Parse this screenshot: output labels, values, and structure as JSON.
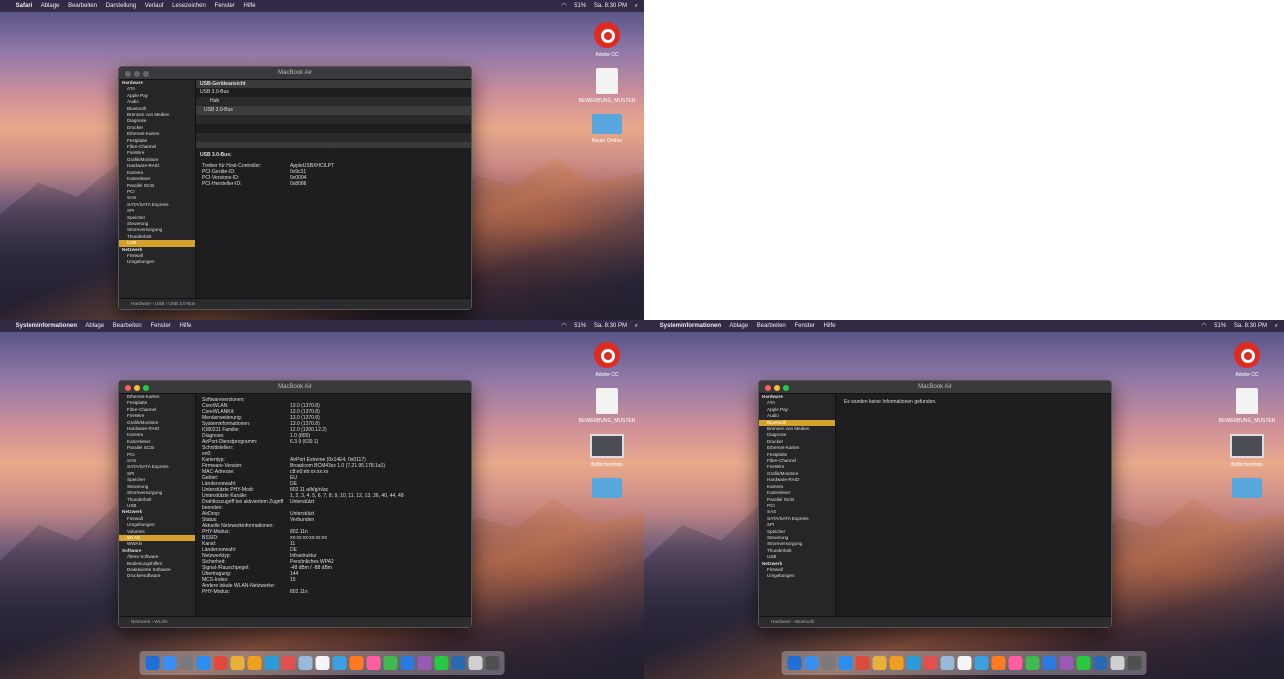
{
  "screens": [
    {
      "menu_app": "Safari",
      "menus": [
        "Ablage",
        "Bearbeiten",
        "Darstellung",
        "Verlauf",
        "Lesezeichen",
        "Fenster",
        "Hilfe"
      ],
      "clock": "Sa. 8:30 PM",
      "battery": "51%",
      "window_title": "MacBook Air",
      "sidebar": [
        {
          "label": "Hardware",
          "group": true
        },
        {
          "label": "ATA"
        },
        {
          "label": "Apple Pay"
        },
        {
          "label": "Audio"
        },
        {
          "label": "Bluetooth"
        },
        {
          "label": "Brennen von Medien"
        },
        {
          "label": "Diagnose"
        },
        {
          "label": "Drucker"
        },
        {
          "label": "Ethernet-Karten"
        },
        {
          "label": "Festplatte"
        },
        {
          "label": "Fibre-Channel"
        },
        {
          "label": "FireWire"
        },
        {
          "label": "Grafik/Monitore"
        },
        {
          "label": "Hardware-RAID"
        },
        {
          "label": "Kamera"
        },
        {
          "label": "Kartenleser"
        },
        {
          "label": "Parallel SCSI"
        },
        {
          "label": "PCI"
        },
        {
          "label": "SAS"
        },
        {
          "label": "SATA/SATA Express"
        },
        {
          "label": "SPI"
        },
        {
          "label": "Speicher"
        },
        {
          "label": "Steuerung"
        },
        {
          "label": "Stromversorgung"
        },
        {
          "label": "Thunderbolt"
        },
        {
          "label": "USB",
          "selected": true
        },
        {
          "label": "Netzwerk",
          "group": true
        },
        {
          "label": "Firewall"
        },
        {
          "label": "Umgebungen"
        }
      ],
      "tree_header": "USB-Geräteansicht",
      "tree": [
        "USB 3.0-Bus",
        "Hub",
        "USB 3.0-Bus"
      ],
      "detail_title": "USB 3.0-Bus:",
      "details": [
        {
          "k": "Treiber für Host-Controller:",
          "v": "AppleUSBXHCILPT"
        },
        {
          "k": "PCI-Geräte-ID:",
          "v": "0x9c31"
        },
        {
          "k": "PCI-Versions-ID:",
          "v": "0x0004"
        },
        {
          "k": "PCI-Hersteller-ID:",
          "v": "0x8086"
        }
      ],
      "breadcrumb": "Hardware › USB › USB 3.0-Bus"
    },
    {
      "menu_app": "Systeminformationen",
      "menus": [
        "Ablage",
        "Bearbeiten",
        "Fenster",
        "Hilfe"
      ],
      "clock": "Sa. 8:30 PM",
      "battery": "51%",
      "window_title": "MacBook Air",
      "sidebar": [
        {
          "label": "Ethernet-Karten"
        },
        {
          "label": "Festplatte"
        },
        {
          "label": "Fibre-Channel"
        },
        {
          "label": "FireWire"
        },
        {
          "label": "Grafik/Monitore"
        },
        {
          "label": "Hardware-RAID"
        },
        {
          "label": "Kamera"
        },
        {
          "label": "Kartenleser"
        },
        {
          "label": "Parallel SCSI"
        },
        {
          "label": "PCI"
        },
        {
          "label": "SAS"
        },
        {
          "label": "SATA/SATA Express"
        },
        {
          "label": "SPI"
        },
        {
          "label": "Speicher"
        },
        {
          "label": "Steuerung"
        },
        {
          "label": "Stromversorgung"
        },
        {
          "label": "Thunderbolt"
        },
        {
          "label": "USB"
        },
        {
          "label": "Netzwerk",
          "group": true
        },
        {
          "label": "Firewall"
        },
        {
          "label": "Umgebungen"
        },
        {
          "label": "Volumes"
        },
        {
          "label": "WLAN",
          "selected": true
        },
        {
          "label": "WWAN"
        },
        {
          "label": "Software",
          "group": true
        },
        {
          "label": "Ältere Software"
        },
        {
          "label": "Bedienungshilfen"
        },
        {
          "label": "Deaktivierte Software"
        },
        {
          "label": "Druckersoftware"
        }
      ],
      "details": [
        {
          "k": "Softwareversionen:",
          "v": ""
        },
        {
          "k": "CoreWLAN:",
          "v": "13.0 (1370.8)"
        },
        {
          "k": "CoreWLANKit:",
          "v": "13.0 (1370.8)"
        },
        {
          "k": "Menüerweiterung:",
          "v": "13.0 (1370.8)"
        },
        {
          "k": "Systeminformationen:",
          "v": "13.0 (1370.8)"
        },
        {
          "k": "IO80211 Familie:",
          "v": "12.0 (1200.12.2)"
        },
        {
          "k": "Diagnose:",
          "v": "1.0 (800)"
        },
        {
          "k": "AirPort-Dienstprogramm:",
          "v": "6.3.9 (639.1)"
        },
        {
          "k": "Schnittstellen:",
          "v": ""
        },
        {
          "k": "en0:",
          "v": ""
        },
        {
          "k": "Kartentyp:",
          "v": "AirPort Extreme (0x14E4, 0x0117)"
        },
        {
          "k": "Firmware-Version:",
          "v": "Broadcom BCM43xx 1.0 (7.21.95.178.1a1)"
        },
        {
          "k": "MAC-Adresse:",
          "v": "c8:e0:eb:xx:xx:xx"
        },
        {
          "k": "Gebiet:",
          "v": "EU"
        },
        {
          "k": "Ländervorwahl:",
          "v": "DE"
        },
        {
          "k": "Unterstützte PHY-Modi:",
          "v": "802.11 a/b/g/n/ac"
        },
        {
          "k": "Unterstützte Kanäle:",
          "v": "1, 2, 3, 4, 5, 6, 7, 8, 9, 10, 11, 12, 13, 36, 40, 44, 48"
        },
        {
          "k": "Drahtloszugriff bei aktiviertem Zugriff beenden:",
          "v": "Unterstützt"
        },
        {
          "k": "AirDrop:",
          "v": "Unterstützt"
        },
        {
          "k": "Status:",
          "v": "Verbunden"
        },
        {
          "k": "Aktuelle Netzwerkinformationen:",
          "v": ""
        },
        {
          "k": "PHY-Modus:",
          "v": "802.11n"
        },
        {
          "k": "BSSID:",
          "v": "xx:xx:xx:xx:xx:xx"
        },
        {
          "k": "Kanal:",
          "v": "11"
        },
        {
          "k": "Ländervorwahl:",
          "v": "DE"
        },
        {
          "k": "Netzwerktyp:",
          "v": "Infrastruktur"
        },
        {
          "k": "Sicherheit:",
          "v": "Persönliches WPA2"
        },
        {
          "k": "Signal-/Rauschpegel:",
          "v": "-48 dBm / -88 dBm"
        },
        {
          "k": "Übertragung:",
          "v": "144"
        },
        {
          "k": "MCS-Index:",
          "v": "15"
        },
        {
          "k": "Andere lokale WLAN-Netzwerke:",
          "v": ""
        },
        {
          "k": "PHY-Modus:",
          "v": "802.11n"
        }
      ],
      "breadcrumb": "Netzwerk › WLAN"
    },
    {
      "menu_app": "Systeminformationen",
      "menus": [
        "Ablage",
        "Bearbeiten",
        "Fenster",
        "Hilfe"
      ],
      "clock": "Sa. 8:30 PM",
      "battery": "51%",
      "window_title": "MacBook Air",
      "sidebar": [
        {
          "label": "Hardware",
          "group": true
        },
        {
          "label": "ATA"
        },
        {
          "label": "Apple Pay"
        },
        {
          "label": "Audio"
        },
        {
          "label": "Bluetooth",
          "selected": true
        },
        {
          "label": "Brennen von Medien"
        },
        {
          "label": "Diagnose"
        },
        {
          "label": "Drucker"
        },
        {
          "label": "Ethernet-Karten"
        },
        {
          "label": "Festplatte"
        },
        {
          "label": "Fibre-Channel"
        },
        {
          "label": "FireWire"
        },
        {
          "label": "Grafik/Monitore"
        },
        {
          "label": "Hardware-RAID"
        },
        {
          "label": "Kamera"
        },
        {
          "label": "Kartenleser"
        },
        {
          "label": "Parallel SCSI"
        },
        {
          "label": "PCI"
        },
        {
          "label": "SAS"
        },
        {
          "label": "SATA/SATA Express"
        },
        {
          "label": "SPI"
        },
        {
          "label": "Speicher"
        },
        {
          "label": "Steuerung"
        },
        {
          "label": "Stromversorgung"
        },
        {
          "label": "Thunderbolt"
        },
        {
          "label": "USB"
        },
        {
          "label": "Netzwerk",
          "group": true
        },
        {
          "label": "Firewall"
        },
        {
          "label": "Umgebungen"
        }
      ],
      "message": "Es wurden keine Informationen gefunden.",
      "breadcrumb": "Hardware › Bluetooth"
    }
  ],
  "desktop_icons": {
    "cc_label": "Adobe CC",
    "doc_label": "BEWERBUNG_MUSTER",
    "shot_label": "Bildschirmfoto",
    "folder_label": "Neuer Ordner"
  },
  "colors": {
    "sidebar_selected": "#d4a12a",
    "window_bg": "#1f1f21",
    "cc_red": "#e02a20",
    "folder_blue": "#5aa7dd"
  }
}
